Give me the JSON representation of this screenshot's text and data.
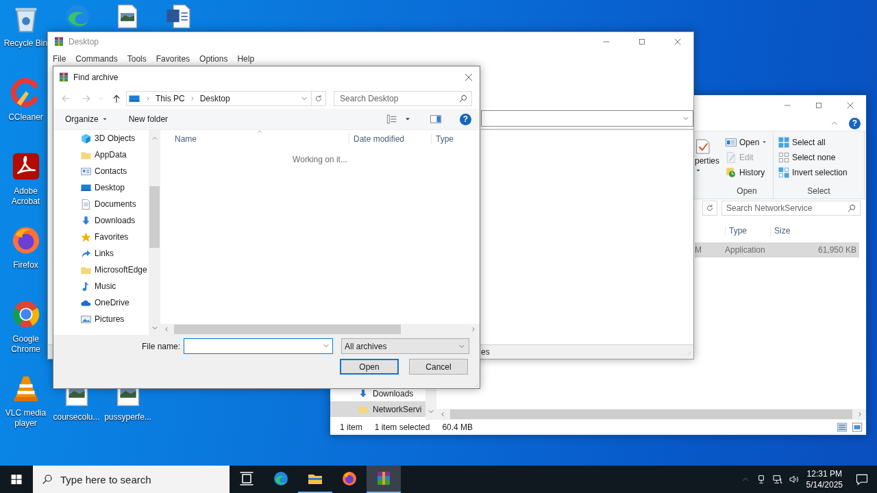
{
  "desktop": {
    "icons": [
      {
        "kind": "recycle",
        "label": "Recycle Bin"
      },
      {
        "kind": "edge"
      },
      {
        "kind": "image"
      },
      {
        "kind": "word"
      },
      {
        "kind": "ccleaner",
        "label": "CCleaner"
      },
      {
        "kind": "acrobat",
        "label": "Adobe Acrobat"
      },
      {
        "kind": "firefox",
        "label": "Firefox"
      },
      {
        "kind": "chrome",
        "label": "Google Chrome"
      },
      {
        "kind": "vlc",
        "label": "VLC media player"
      },
      {
        "kind": "image",
        "label": "coursecolu..."
      },
      {
        "kind": "image",
        "label": "pussyperfe..."
      }
    ]
  },
  "explorer": {
    "ribbon": {
      "properties_fragment": "perties",
      "groups": [
        {
          "kind": "open",
          "label": "Open",
          "items": [
            {
              "label": "Open",
              "kind": "open",
              "disabled": false
            },
            {
              "label": "Edit",
              "kind": "edit",
              "disabled": true
            },
            {
              "label": "History",
              "kind": "history",
              "disabled": false
            }
          ]
        },
        {
          "kind": "select",
          "label": "Select",
          "items": [
            {
              "label": "Select all",
              "kind": "selall",
              "disabled": false
            },
            {
              "label": "Select none",
              "kind": "selnone",
              "disabled": false
            },
            {
              "label": "Invert selection",
              "kind": "selinv",
              "disabled": false
            }
          ]
        }
      ]
    },
    "help": "?",
    "search": {
      "placeholder": "Search NetworkService"
    },
    "columns": [
      "",
      "Type",
      "Size"
    ],
    "rows": [
      {
        "cells": [
          "M",
          "Application",
          "61,950 KB"
        ],
        "selected": true
      }
    ],
    "nav": [
      {
        "label": "Downloads",
        "kind": "downloads",
        "selected": false
      },
      {
        "label": "NetworkServi",
        "kind": "folder",
        "selected": true
      }
    ],
    "status": [
      "1 item",
      "1 item selected",
      "60.4 MB"
    ]
  },
  "winrar": {
    "title": "Desktop",
    "menu": [
      "File",
      "Commands",
      "Tools",
      "Favorites",
      "Options",
      "Help"
    ],
    "status_text": "es"
  },
  "dialog": {
    "title": "Find archive",
    "breadcrumb": [
      "This PC",
      "Desktop"
    ],
    "search": {
      "placeholder": "Search Desktop"
    },
    "toolbar": {
      "organize": "Organize",
      "new_folder": "New folder",
      "help": "?"
    },
    "tree": [
      {
        "label": "3D Objects",
        "kind": "cube"
      },
      {
        "label": "AppData",
        "kind": "folder"
      },
      {
        "label": "Contacts",
        "kind": "contacts"
      },
      {
        "label": "Desktop",
        "kind": "desktop"
      },
      {
        "label": "Documents",
        "kind": "documents"
      },
      {
        "label": "Downloads",
        "kind": "downloads"
      },
      {
        "label": "Favorites",
        "kind": "star"
      },
      {
        "label": "Links",
        "kind": "links"
      },
      {
        "label": "MicrosoftEdge",
        "kind": "folder"
      },
      {
        "label": "Music",
        "kind": "music"
      },
      {
        "label": "OneDrive",
        "kind": "cloud"
      },
      {
        "label": "Pictures",
        "kind": "pictures"
      }
    ],
    "columns": [
      "Name",
      "Date modified",
      "Type"
    ],
    "message": "Working on it...",
    "file_name_label": "File name:",
    "filter": "All archives",
    "buttons": [
      {
        "label": "Open",
        "default": true
      },
      {
        "label": "Cancel",
        "default": false
      }
    ]
  },
  "taskbar": {
    "search_placeholder": "Type here to search",
    "apps": [
      {
        "kind": "taskview",
        "running": false,
        "active": false
      },
      {
        "kind": "edge",
        "running": false,
        "active": false
      },
      {
        "kind": "explorer",
        "running": true,
        "active": false
      },
      {
        "kind": "firefox",
        "running": false,
        "active": false
      },
      {
        "kind": "winrar",
        "running": true,
        "active": true
      }
    ],
    "time": "12:31 PM",
    "date": "5/14/2025"
  }
}
